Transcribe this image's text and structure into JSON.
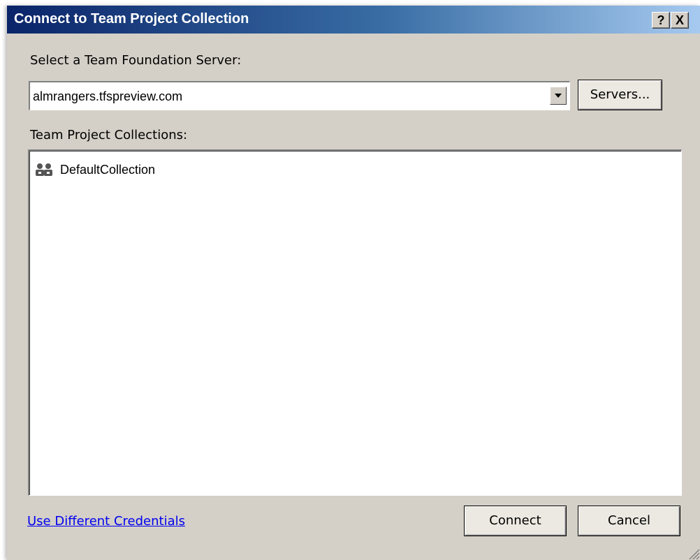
{
  "window": {
    "title": "Connect to Team Project Collection",
    "help_label": "?",
    "close_label": "X"
  },
  "server": {
    "label": "Select a Team Foundation Server:",
    "value": "almrangers.tfspreview.com",
    "servers_button": "Servers..."
  },
  "collections": {
    "label": "Team Project Collections:",
    "items": [
      {
        "label": "DefaultCollection",
        "icon": "team-collection-icon"
      }
    ]
  },
  "footer": {
    "credentials_link": "Use Different Credentials",
    "connect_button": "Connect",
    "cancel_button": "Cancel"
  },
  "colors": {
    "title_gradient_start": "#0a246a",
    "title_gradient_end": "#a6caf0",
    "dialog_bg": "#d4d0c8",
    "link": "#0000ee"
  }
}
